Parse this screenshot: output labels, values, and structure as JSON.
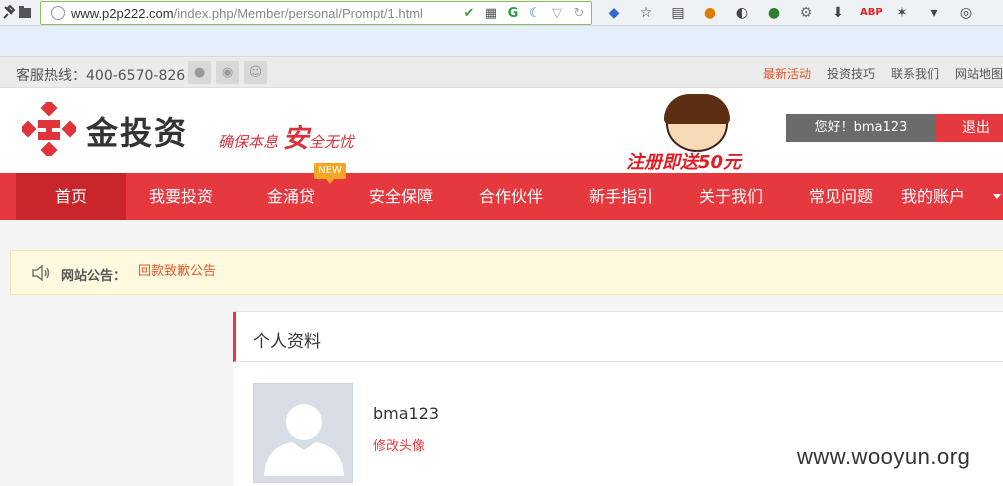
{
  "browser": {
    "url_host": "www.p2p222.com",
    "url_path": "/index.php/Member/personal/Prompt/1.html"
  },
  "topbar": {
    "hotline": "客服热线：400-6570-826",
    "links": [
      "最新活动",
      "投资技巧",
      "联系我们",
      "网站地图"
    ],
    "social_icons": [
      "wechat-icon",
      "weibo-icon",
      "user-icon"
    ]
  },
  "header": {
    "logo_text": "金投资",
    "slogan_part1": "确保本息",
    "slogan_big": "安",
    "slogan_part2": "全无忧",
    "promo_text": "注册即送50元",
    "greeting": "您好！bma123",
    "logout": "退出"
  },
  "nav": {
    "items": [
      "首页",
      "我要投资",
      "金涌贷",
      "安全保障",
      "合作伙伴",
      "新手指引",
      "关于我们",
      "常见问题",
      "我的账户"
    ],
    "active_index": 0,
    "new_badge": "NEW"
  },
  "notice": {
    "label": "网站公告：",
    "link": "回款致歉公告"
  },
  "profile": {
    "title": "个人资料",
    "username": "bma123",
    "edit_avatar": "修改头像"
  },
  "watermark": "www.wooyun.org",
  "colors": {
    "brand_red": "#e6393f",
    "nav_active": "#c9262c",
    "link_orange": "#e3582b"
  }
}
